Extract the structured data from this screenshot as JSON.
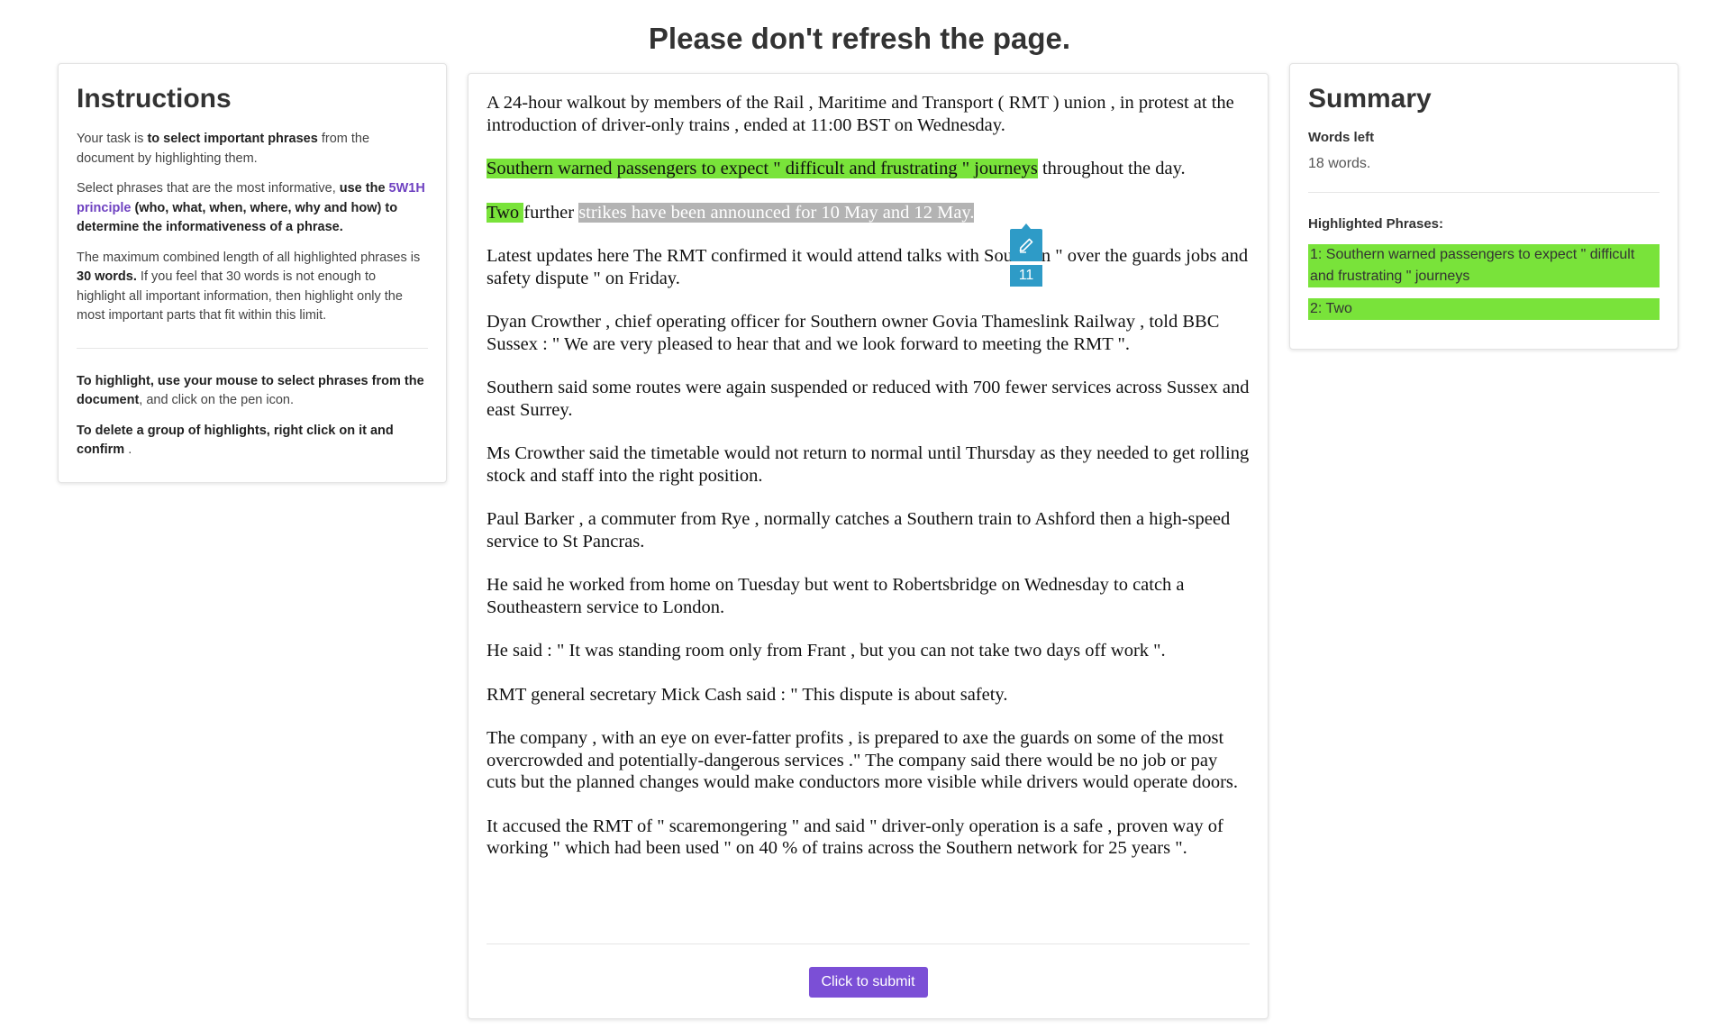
{
  "header": {
    "title": "Please don't refresh the page."
  },
  "instructions": {
    "title": "Instructions",
    "p1": {
      "a": "Your task is ",
      "b": "to select important phrases",
      "c": " from the document by highlighting them."
    },
    "p2": {
      "a": "Select phrases that are the most informative, ",
      "b": "use the ",
      "link": "5W1H principle",
      "c": " (who, what, when, where, why and how) to determine the informativeness of a phrase."
    },
    "p3": {
      "a": "The maximum combined length of all highlighted phrases is ",
      "b": "30 words.",
      "c": " If you feel that 30 words is not enough to highlight all important information, then highlight only the most important parts that fit within this limit."
    },
    "p4": {
      "b": "To highlight, use your mouse to select phrases from the document",
      "c": ", and click on the pen icon."
    },
    "p5": {
      "b": "To delete a group of highlights, right click on it and confirm",
      "c": " ."
    }
  },
  "document": {
    "p1": "A 24-hour walkout by members of the Rail , Maritime and Transport ( RMT ) union , in protest at the introduction of driver-only trains , ended at 11:00 BST on Wednesday.",
    "p2": {
      "highlight": "Southern warned passengers to expect \" difficult and frustrating \" journeys",
      "rest": " throughout the day."
    },
    "p3": {
      "highlight": "Two ",
      "mid": "further ",
      "selected": "strikes have been announced for 10 May and 12 May. "
    },
    "p4": "Latest updates here The RMT confirmed it would attend talks with Southern \" over the guards jobs and safety dispute \" on Friday.",
    "p5": "Dyan Crowther , chief operating officer for Southern owner Govia Thameslink Railway , told BBC Sussex : \" We are very pleased to hear that and we look forward to meeting the RMT \".",
    "p6": "Southern said some routes were again suspended or reduced with 700 fewer services across Sussex and east Surrey.",
    "p7": "Ms Crowther said the timetable would not return to normal until Thursday as they needed to get rolling stock and staff into the right position.",
    "p8": "Paul Barker , a commuter from Rye , normally catches a Southern train to Ashford then a high-speed service to St Pancras.",
    "p9": "He said he worked from home on Tuesday but went to Robertsbridge on Wednesday to catch a Southeastern service to London.",
    "p10": "He said : \" It was standing room only from Frant , but you can not take two days off work \".",
    "p11": "RMT general secretary Mick Cash said : \" This dispute is about safety.",
    "p12": "The company , with an eye on ever-fatter profits , is prepared to axe the guards on some of the most overcrowded and potentially-dangerous services .\" The company said there would be no job or pay cuts but the planned changes would make conductors more visible while drivers would operate doors.",
    "p13": "It accused the RMT of \" scaremongering \" and said \" driver-only operation is a safe , proven way of working \" which had been used \" on 40 % of trains across the Southern network for 25 years \".",
    "submit_label": "Click to submit"
  },
  "pen_popup": {
    "icon": "pen-icon",
    "count": "11"
  },
  "summary": {
    "title": "Summary",
    "words_left_label": "Words left",
    "words_left_value": "18 words.",
    "phrases_label": "Highlighted Phrases:",
    "phrases": [
      "1: Southern warned passengers to expect \" difficult and frustrating \" journeys",
      "2: Two"
    ]
  },
  "colors": {
    "highlight": "#79e33a",
    "selection": "#b3b3b3",
    "accent": "#7b4fd6",
    "pen": "#2e9bc7"
  }
}
